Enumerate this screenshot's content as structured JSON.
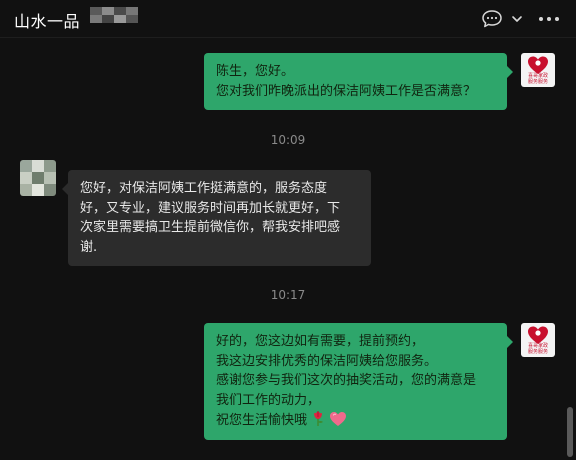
{
  "header": {
    "title": "山水一品",
    "icons": [
      "chat-bubble-icon",
      "chevron-down-icon",
      "more-icon"
    ]
  },
  "avatar_self": {
    "logo_line_1": "喜哥家政",
    "logo_line_2": "服务服务"
  },
  "messages": [
    {
      "type": "outgoing",
      "lines": [
        "陈生，您好。",
        "您对我们昨晚派出的保洁阿姨工作是否满意？"
      ]
    },
    {
      "type": "timestamp",
      "text": "10:09"
    },
    {
      "type": "incoming",
      "lines": [
        "您好，对保洁阿姨工作挺满意的，服务态度",
        "好，又专业，建议服务时间再加长就更好，下",
        "次家里需要搞卫生提前微信你，帮我安排吧感",
        "谢."
      ]
    },
    {
      "type": "timestamp",
      "text": "10:17"
    },
    {
      "type": "outgoing",
      "lines": [
        "好的，您这边如有需要，提前预约，",
        "我这边安排优秀的保洁阿姨给您服务。",
        "感谢您参与我们这次的抽奖活动，您的满意是",
        "我们工作的动力，",
        "祝您生活愉快哦"
      ],
      "trailing_emoji": [
        "rose-emoji",
        "heart-emoji"
      ]
    }
  ],
  "colors": {
    "background": "#111111",
    "outgoing_bubble": "#2ea66b",
    "incoming_bubble": "#2c2c2c",
    "timestamp": "#8a8a8a",
    "logo_red": "#c8102e"
  }
}
